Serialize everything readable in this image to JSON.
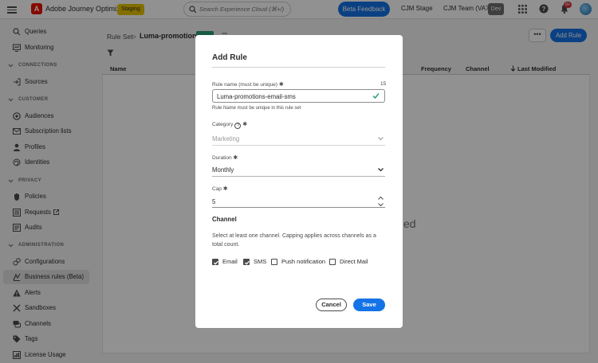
{
  "app": {
    "name": "Adobe Journey Optimizer",
    "env_badge": "Staging",
    "search_placeholder": "Search Experience Cloud (⌘+/)",
    "beta_feedback": "Beta Feedback",
    "org_stage": "CJM Stage",
    "org_team": "CJM Team (VA7)",
    "env_dev": "Dev",
    "notification_count": "9+",
    "accent_color": "#1473e6"
  },
  "sidebar": {
    "items": [
      {
        "label": "Queries",
        "icon": "queries-icon"
      },
      {
        "label": "Monitoring",
        "icon": "monitoring-icon"
      },
      {
        "section": "CONNECTIONS"
      },
      {
        "label": "Sources",
        "icon": "sources-icon"
      },
      {
        "section": "CUSTOMER"
      },
      {
        "label": "Audiences",
        "icon": "audiences-icon"
      },
      {
        "label": "Subscription lists",
        "icon": "subscription-lists-icon"
      },
      {
        "label": "Profiles",
        "icon": "profiles-icon"
      },
      {
        "label": "Identities",
        "icon": "identities-icon"
      },
      {
        "section": "PRIVACY"
      },
      {
        "label": "Policies",
        "icon": "policies-icon"
      },
      {
        "label": "Requests",
        "icon": "requests-icon"
      },
      {
        "label": "Audits",
        "icon": "audits-icon"
      },
      {
        "section": "ADMINISTRATION"
      },
      {
        "label": "Configurations",
        "icon": "configurations-icon"
      },
      {
        "label": "Business rules (Beta)",
        "icon": "business-rules-icon",
        "active": true
      },
      {
        "label": "Alerts",
        "icon": "alerts-icon"
      },
      {
        "label": "Sandboxes",
        "icon": "sandboxes-icon"
      },
      {
        "label": "Channels",
        "icon": "channels-icon"
      },
      {
        "label": "Tags",
        "icon": "tags-icon"
      },
      {
        "label": "License Usage",
        "icon": "license-usage-icon"
      }
    ]
  },
  "page": {
    "breadcrumb_parent": "Rule Set",
    "breadcrumb_current": "Luma-promotions",
    "add_rule": "Add Rule",
    "more": "•••",
    "columns": [
      "Name",
      "Frequency",
      "Channel",
      "Last Modified"
    ],
    "empty_fragment": "ed"
  },
  "modal": {
    "title": "Add Rule",
    "rule_name_label": "Rule name (must be unique)",
    "rule_name_count": "15",
    "rule_name_value": "Luma-promotions-email-sms",
    "rule_name_helper": "Rule Name must be unique in this rule set",
    "category_label": "Category",
    "category_value": "Marketing",
    "duration_label": "Duration",
    "duration_value": "Monthly",
    "cap_label": "Cap",
    "cap_value": "5",
    "channel_heading": "Channel",
    "channel_description": "Select at least one channel. Capping applies across channels as a total count.",
    "channels": [
      {
        "label": "Email",
        "checked": true
      },
      {
        "label": "SMS",
        "checked": true
      },
      {
        "label": "Push notification",
        "checked": false
      },
      {
        "label": "Direct Mail",
        "checked": false
      }
    ],
    "cancel": "Cancel",
    "save": "Save"
  }
}
